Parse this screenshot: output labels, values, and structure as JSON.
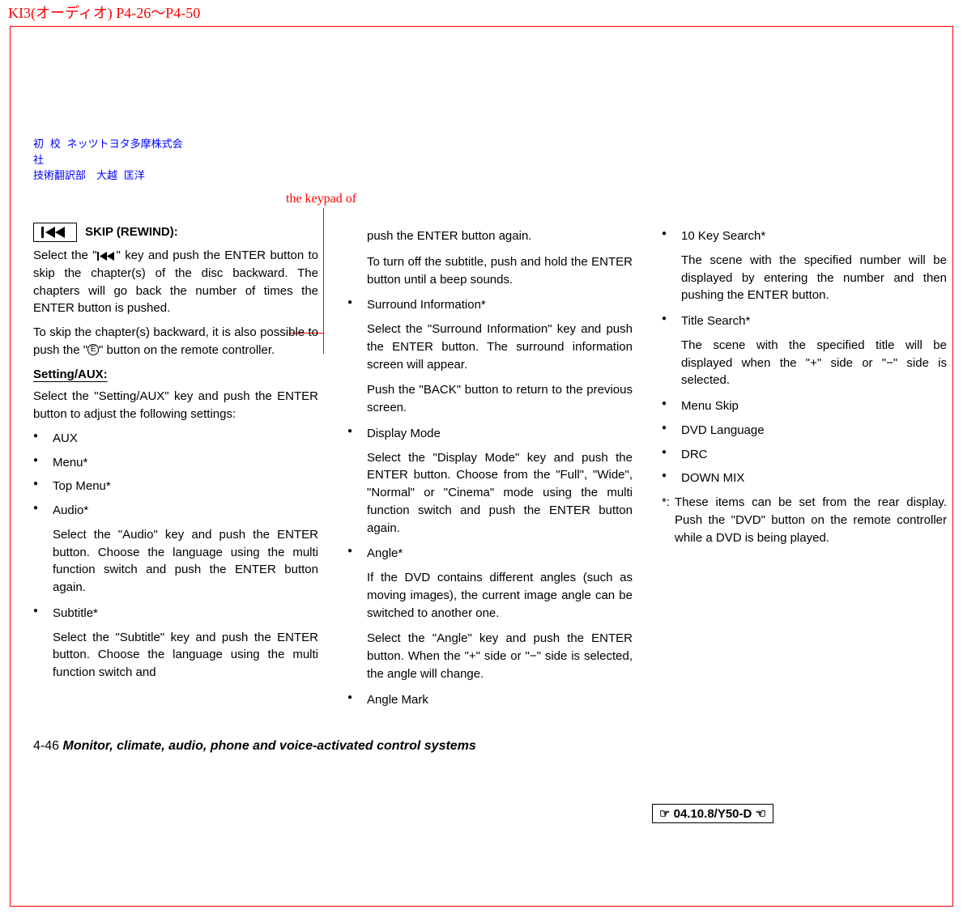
{
  "header_note": "KI3(オーディオ) P4-26～P4-50",
  "signature": "初 校 ネッツトヨタ多摩株式会社­\n技術翻訳部　大越 匡洋",
  "inline_annotation": "the keypad of",
  "col1": {
    "skip_label": "SKIP (REWIND):",
    "skip_p1": "Select the \" \" key and push the ENTER button to skip the chapter(s) of the disc backward. The chapters will go back the number of times the ENTER button is pushed.",
    "skip_p1_before": "Select the \"",
    "skip_p1_after": "\" key and push the ENTER button to skip the chapter(s) of the disc backward. The chapters will go back the number of times the ENTER button is pushed.",
    "skip_p2_before": "To skip the chapter(s) backward, it is also possible to push the \"",
    "skip_p2_after": "\" button on the remote controller.",
    "setting_heading": "Setting/AUX:",
    "setting_p": "Select the \"Setting/AUX\" key and push the ENTER button to adjust the following settings:",
    "items": [
      {
        "label": "AUX"
      },
      {
        "label": "Menu*"
      },
      {
        "label": "Top Menu*"
      },
      {
        "label": "Audio*",
        "desc": "Select the \"Audio\" key and push the ENTER button. Choose the language using the multi function switch and push the ENTER button again."
      },
      {
        "label": "Subtitle*",
        "desc": "Select the \"Subtitle\" key and push the ENTER button. Choose the language using the multi function switch and"
      }
    ]
  },
  "col2": {
    "cont_p1": "push the ENTER button again.",
    "cont_p2": "To turn off the subtitle, push and hold the ENTER button until a beep sounds.",
    "items": [
      {
        "label": "Surround Information*",
        "desc1": "Select the \"Surround Information\" key and push the ENTER button. The surround information screen will appear.",
        "desc2": "Push the \"BACK\" button to return to the previous screen."
      },
      {
        "label": "Display Mode",
        "desc1": "Select the \"Display Mode\" key and push the ENTER button. Choose from the \"Full\", \"Wide\", \"Normal\" or \"Cinema\" mode using the multi function switch and push the ENTER button again."
      },
      {
        "label": "Angle*",
        "desc1": "If the DVD contains different angles (such as moving images), the current image angle can be switched to another one.",
        "desc2": "Select the \"Angle\" key and push the ENTER button. When the \"+\" side or \"−\" side is selected, the angle will change."
      },
      {
        "label": "Angle Mark"
      }
    ]
  },
  "col3": {
    "items": [
      {
        "label": "10 Key Search*",
        "desc": "The scene with the specified number will be displayed by entering the number and then pushing the ENTER button."
      },
      {
        "label": "Title Search*",
        "desc": "The scene with the specified title will be displayed when the \"+\" side or \"−\" side is selected."
      },
      {
        "label": "Menu Skip"
      },
      {
        "label": "DVD Language"
      },
      {
        "label": "DRC"
      },
      {
        "label": "DOWN MIX"
      }
    ],
    "footnote_label": "*:",
    "footnote_text": "These items can be set from the rear display. Push the \"DVD\" button on the remote controller while a DVD is being played."
  },
  "footer": {
    "page_num": "4-46",
    "section_title": "Monitor, climate, audio, phone and voice-activated control systems"
  },
  "revision": "☞ 04.10.8/Y50-D ☜"
}
